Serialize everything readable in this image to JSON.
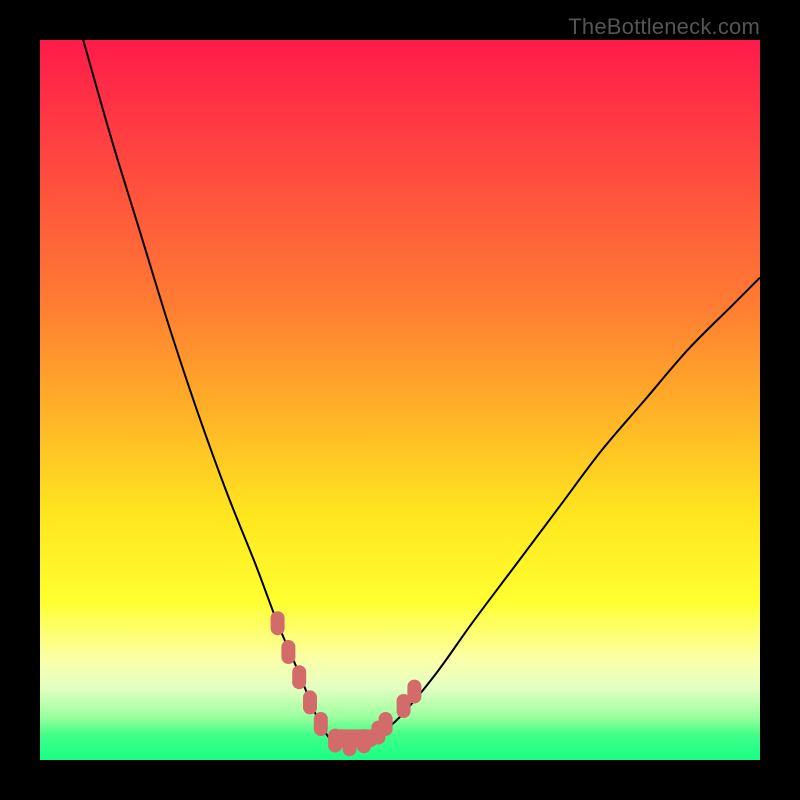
{
  "watermark": "TheBottleneck.com",
  "colors": {
    "frame": "#000000",
    "gradient_stops": [
      {
        "pos": 0.0,
        "color": "#ff1b4b"
      },
      {
        "pos": 0.18,
        "color": "#ff4a3f"
      },
      {
        "pos": 0.36,
        "color": "#ff7a33"
      },
      {
        "pos": 0.52,
        "color": "#ffb327"
      },
      {
        "pos": 0.66,
        "color": "#ffe61f"
      },
      {
        "pos": 0.78,
        "color": "#ffff30"
      },
      {
        "pos": 0.86,
        "color": "#fcffa8"
      },
      {
        "pos": 0.9,
        "color": "#e2ffc2"
      },
      {
        "pos": 0.94,
        "color": "#9cff9f"
      },
      {
        "pos": 0.965,
        "color": "#41ff88"
      },
      {
        "pos": 1.0,
        "color": "#1aff86"
      }
    ],
    "curve_stroke": "#000000",
    "marker_fill": "#d46b6b",
    "marker_stroke": "#c65a5a"
  },
  "chart_data": {
    "type": "line",
    "title": "",
    "xlabel": "",
    "ylabel": "",
    "xlim": [
      0,
      100
    ],
    "ylim": [
      0,
      100
    ],
    "series": [
      {
        "name": "bottleneck-curve",
        "x": [
          6,
          10,
          14,
          18,
          22,
          26,
          30,
          33,
          36,
          38,
          39.5,
          41,
          43,
          45,
          47,
          50,
          55,
          60,
          66,
          72,
          78,
          84,
          90,
          96,
          100
        ],
        "values": [
          100,
          86,
          73,
          60,
          48,
          37,
          27,
          19,
          12,
          7,
          4,
          2.3,
          2,
          2.3,
          3.5,
          6,
          12,
          19,
          27,
          35,
          43,
          50,
          57,
          63,
          67
        ]
      }
    ],
    "markers": [
      {
        "x": 33.0,
        "y": 19.0
      },
      {
        "x": 34.5,
        "y": 15.0
      },
      {
        "x": 36.0,
        "y": 11.5
      },
      {
        "x": 37.5,
        "y": 8.0
      },
      {
        "x": 39.0,
        "y": 5.0
      },
      {
        "x": 41.0,
        "y": 2.7
      },
      {
        "x": 43.0,
        "y": 2.2
      },
      {
        "x": 45.0,
        "y": 2.6
      },
      {
        "x": 47.0,
        "y": 3.8
      },
      {
        "x": 48.0,
        "y": 5.0
      },
      {
        "x": 50.5,
        "y": 7.5
      },
      {
        "x": 52.0,
        "y": 9.5
      }
    ],
    "flat_band": {
      "y_min": 0,
      "y_max": 3,
      "x_min": 40,
      "x_max": 47
    }
  }
}
